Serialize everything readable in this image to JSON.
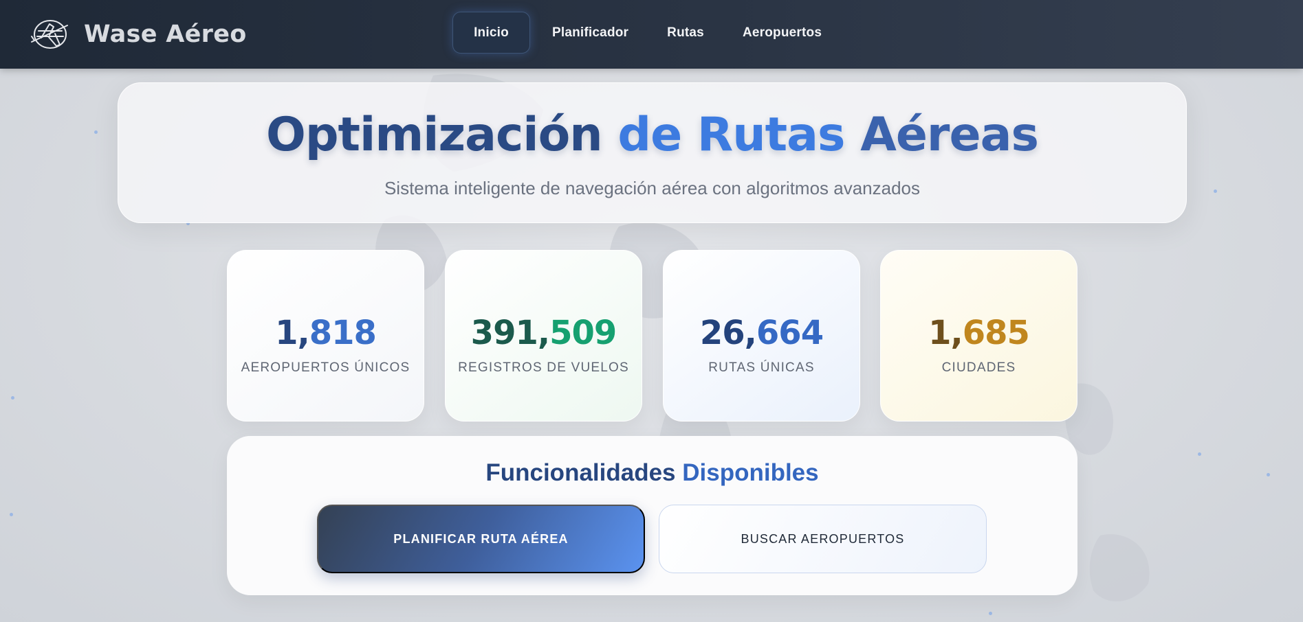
{
  "app": {
    "brand_name": "Wase Aéreo",
    "logo_icon": "airplane-logo-icon"
  },
  "nav": {
    "items": [
      {
        "label": "Inicio",
        "active": true
      },
      {
        "label": "Planificador",
        "active": false
      },
      {
        "label": "Rutas",
        "active": false
      },
      {
        "label": "Aeropuertos",
        "active": false
      }
    ]
  },
  "hero": {
    "title_part1": "Optimización",
    "title_part2": "de Rutas",
    "title_part3": "Aéreas",
    "subtitle": "Sistema inteligente de navegación aérea con algoritmos avanzados"
  },
  "stats": [
    {
      "value_a": "1,",
      "value_b": "818",
      "label": "AEROPUERTOS ÚNICOS",
      "accent": "#3a6fc8"
    },
    {
      "value_a": "391,",
      "value_b": "509",
      "label": "REGISTROS DE VUELOS",
      "accent": "#16a070"
    },
    {
      "value_a": "26,",
      "value_b": "664",
      "label": "RUTAS ÚNICAS",
      "accent": "#3569c4"
    },
    {
      "value_a": "1,",
      "value_b": "685",
      "label": "CIUDADES",
      "accent": "#c0861e"
    }
  ],
  "features": {
    "title_part1": "Funcionalidades",
    "title_part2": "Disponibles",
    "primary_button": "PLANIFICAR RUTA AÉREA",
    "secondary_button": "BUSCAR AEROPUERTOS"
  },
  "colors": {
    "navbar": "#1f2937",
    "accent_blue": "#3d7be0",
    "primary_dark": "#2a4a84"
  }
}
